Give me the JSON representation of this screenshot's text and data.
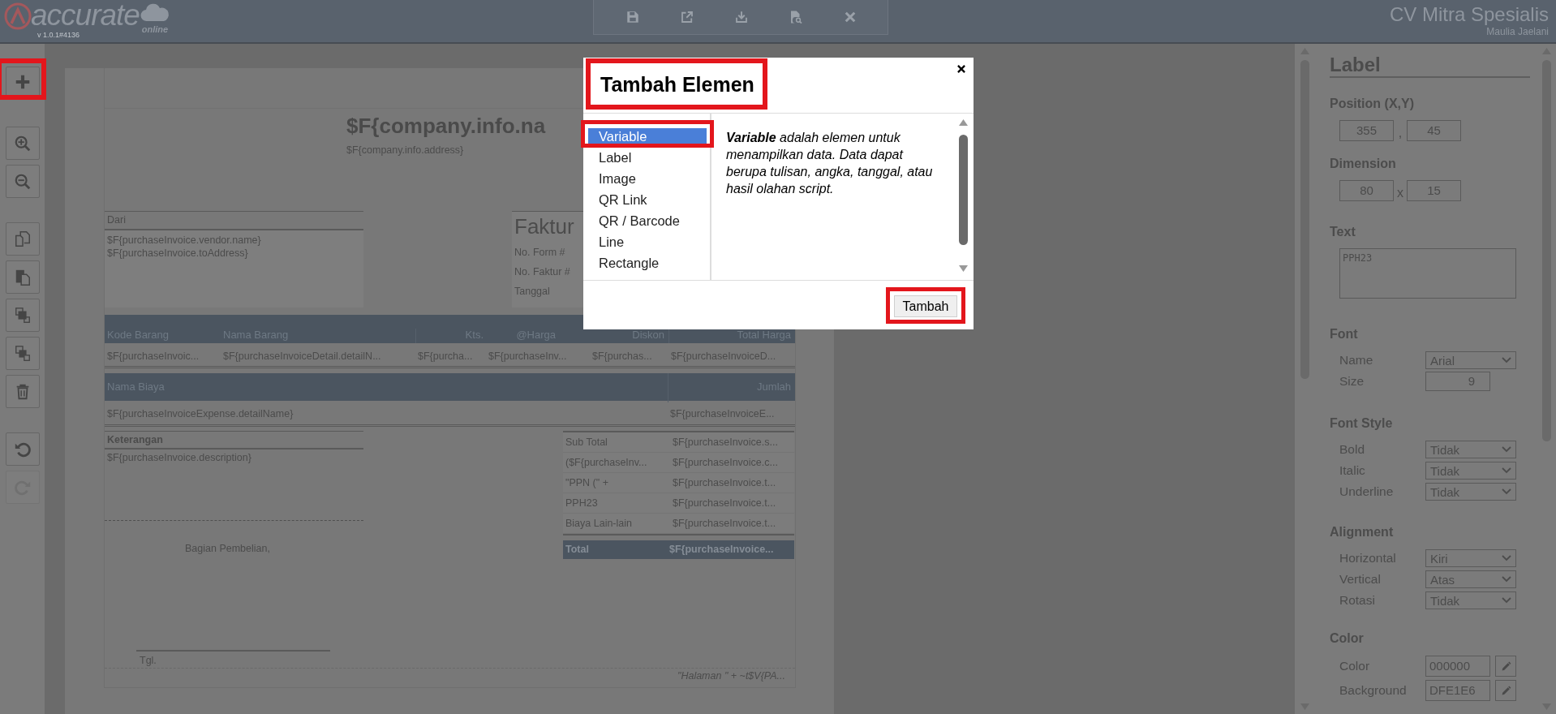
{
  "header": {
    "brand": "accurate",
    "version": "v 1.0.1#4136",
    "brand_tag": "online",
    "company": "CV Mitra Spesialis",
    "user": "Maulia Jaelani"
  },
  "file_toolbar": [
    {
      "kind": "save"
    },
    {
      "kind": "export"
    },
    {
      "kind": "import"
    },
    {
      "kind": "preview"
    },
    {
      "kind": "close"
    }
  ],
  "tool_groups": [
    [
      {
        "kind": "add",
        "disabled": false,
        "highlighted": true
      }
    ],
    [
      {
        "kind": "zoom_in",
        "disabled": false,
        "highlighted": false
      },
      {
        "kind": "zoom_out",
        "disabled": false,
        "highlighted": false
      }
    ],
    [
      {
        "kind": "copy",
        "disabled": false,
        "highlighted": false
      },
      {
        "kind": "paste",
        "disabled": false,
        "highlighted": false
      },
      {
        "kind": "bring_front",
        "disabled": false,
        "highlighted": false
      },
      {
        "kind": "send_back",
        "disabled": false,
        "highlighted": false
      },
      {
        "kind": "delete",
        "disabled": false,
        "highlighted": false
      }
    ],
    [
      {
        "kind": "undo",
        "disabled": false,
        "highlighted": false
      },
      {
        "kind": "redo",
        "disabled": true,
        "highlighted": false
      }
    ]
  ],
  "document": {
    "company_name": "$F{company.info.na",
    "company_address": "$F{company.info.address}",
    "from": {
      "label": "Dari",
      "lines": [
        "$F{purchaseInvoice.vendor.name}",
        "$F{purchaseInvoice.toAddress}"
      ]
    },
    "invoice": {
      "title": "Faktur",
      "fields": [
        "No. Form #",
        "No. Faktur #",
        "Tanggal"
      ]
    },
    "items_table": {
      "columns": [
        "Kode Barang",
        "Nama Barang",
        "Kts.",
        "@Harga",
        "Diskon",
        "Total Harga"
      ],
      "row": [
        "$F{purchaseInvoic...",
        "$F{purchaseInvoiceDetail.detailN...",
        "$F{purcha...",
        "$F{purchaseInv...",
        "$F{purchas...",
        "$F{purchaseInvoiceD..."
      ]
    },
    "expense_table": {
      "columns": [
        "Nama Biaya",
        "Jumlah"
      ],
      "row": [
        "$F{purchaseInvoiceExpense.detailName}",
        "$F{purchaseInvoiceE..."
      ]
    },
    "notes": {
      "label": "Keterangan",
      "value": "$F{purchaseInvoice.description}"
    },
    "summary": [
      {
        "label": "Sub Total",
        "value": "$F{purchaseInvoice.s..."
      },
      {
        "label": "($F{purchaseInv...",
        "value": "$F{purchaseInvoice.c..."
      },
      {
        "label": "\"PPN (\" +",
        "value": "$F{purchaseInvoice.t..."
      },
      {
        "label": "PPH23",
        "value": "$F{purchaseInvoice.t..."
      },
      {
        "label": "Biaya Lain-lain",
        "value": "$F{purchaseInvoice.t..."
      }
    ],
    "total": {
      "label": "Total",
      "value": "$F{purchaseInvoice..."
    },
    "signature": {
      "title": "Bagian Pembelian,",
      "date_label": "Tgl."
    },
    "footer": "\"Halaman \" +  ~t$V{PA..."
  },
  "dialog": {
    "title": "Tambah Elemen",
    "title_highlighted": true,
    "items": [
      {
        "label": "Variable",
        "selected": true,
        "highlighted": true
      },
      {
        "label": "Label",
        "selected": false,
        "highlighted": false
      },
      {
        "label": "Image",
        "selected": false,
        "highlighted": false
      },
      {
        "label": "QR Link",
        "selected": false,
        "highlighted": false
      },
      {
        "label": "QR / Barcode",
        "selected": false,
        "highlighted": false
      },
      {
        "label": "Line",
        "selected": false,
        "highlighted": false
      },
      {
        "label": "Rectangle",
        "selected": false,
        "highlighted": false
      }
    ],
    "description": "**Variable** adalah elemen untuk menampilkan data. Data dapat berupa tulisan, angka, tanggal, atau hasil olahan script.",
    "button": {
      "label": "Tambah",
      "highlighted": true
    }
  },
  "properties": {
    "title": "Label",
    "sections": [
      {
        "kind": "pair",
        "heading": "Position (X,Y)",
        "values": [
          "355",
          "45"
        ],
        "separator": ","
      },
      {
        "kind": "pair",
        "heading": "Dimension",
        "values": [
          "80",
          "15"
        ],
        "separator": "x"
      },
      {
        "kind": "text",
        "heading": "Text",
        "value": "PPH23"
      },
      {
        "kind": "rows",
        "heading": "Font",
        "rows": [
          {
            "kind": "select",
            "label": "Name",
            "value": "Arial"
          },
          {
            "kind": "number",
            "label": "Size",
            "value": "9"
          }
        ]
      },
      {
        "kind": "rows",
        "heading": "Font Style",
        "rows": [
          {
            "kind": "select",
            "label": "Bold",
            "value": "Tidak"
          },
          {
            "kind": "select",
            "label": "Italic",
            "value": "Tidak"
          },
          {
            "kind": "select",
            "label": "Underline",
            "value": "Tidak"
          }
        ]
      },
      {
        "kind": "rows",
        "heading": "Alignment",
        "rows": [
          {
            "kind": "select",
            "label": "Horizontal",
            "value": "Kiri"
          },
          {
            "kind": "select",
            "label": "Vertical",
            "value": "Atas"
          },
          {
            "kind": "select",
            "label": "Rotasi",
            "value": "Tidak"
          }
        ]
      },
      {
        "kind": "rows",
        "heading": "Color",
        "rows": [
          {
            "kind": "color",
            "label": "Color",
            "value": "000000"
          },
          {
            "kind": "color",
            "label": "Background",
            "value": "DFE1E6"
          }
        ]
      }
    ]
  }
}
